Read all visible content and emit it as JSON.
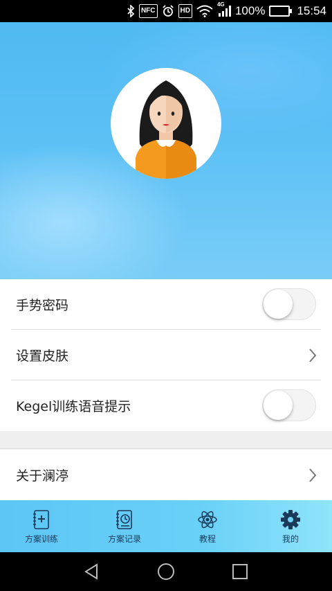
{
  "status_bar": {
    "battery_percent": "100%",
    "time": "15:54",
    "network_label": "4G",
    "nfc_label": "NFC",
    "hd_label": "HD",
    "icons": [
      "bluetooth-icon",
      "nfc-icon",
      "alarm-icon",
      "hd-icon",
      "wifi-icon",
      "signal-icon",
      "battery-icon"
    ]
  },
  "profile": {
    "avatar_icon": "female-avatar"
  },
  "settings": {
    "gesture_password": {
      "label": "手势密码",
      "enabled": false
    },
    "set_skin": {
      "label": "设置皮肤"
    },
    "kegel_voice": {
      "label": "Kegel训练语音提示",
      "enabled": false
    },
    "about": {
      "label": "关于澜渟"
    }
  },
  "tabbar": {
    "tabs": [
      {
        "label": "方案训练",
        "icon": "plan-training-icon"
      },
      {
        "label": "方案记录",
        "icon": "plan-record-icon"
      },
      {
        "label": "教程",
        "icon": "atom-tutorial-icon"
      },
      {
        "label": "我的",
        "icon": "gear-icon",
        "active": true
      }
    ]
  },
  "nav": {
    "buttons": [
      "back-icon",
      "home-icon",
      "recents-icon"
    ]
  }
}
